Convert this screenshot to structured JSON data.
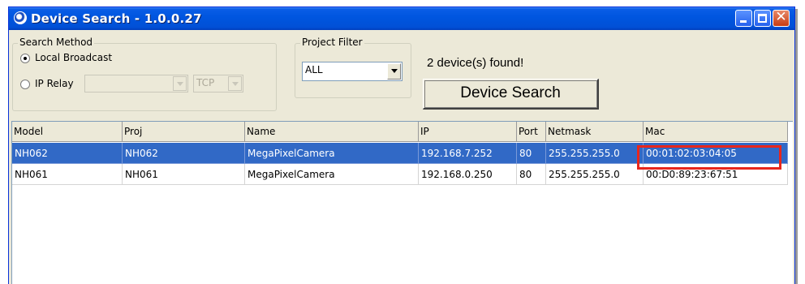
{
  "window": {
    "title": "Device Search - 1.0.0.27"
  },
  "search_method": {
    "legend": "Search Method",
    "local_broadcast_label": "Local Broadcast",
    "ip_relay_label": "IP Relay",
    "ip_relay_value": "",
    "protocol_value": "TCP",
    "selected": "Local Broadcast"
  },
  "project_filter": {
    "legend": "Project Filter",
    "value": "ALL"
  },
  "status_text": "2 device(s) found!",
  "search_button_label": "Device Search",
  "table": {
    "columns": [
      "Model",
      "Proj",
      "Name",
      "IP",
      "Port",
      "Netmask",
      "Mac"
    ],
    "rows": [
      [
        "NH062",
        "NH062",
        "MegaPixelCamera",
        "192.168.7.252",
        "80",
        "255.255.255.0",
        "00:01:02:03:04:05"
      ],
      [
        "NH061",
        "NH061",
        "MegaPixelCamera",
        "192.168.0.250",
        "80",
        "255.255.255.0",
        "00:D0:89:23:67:51"
      ]
    ],
    "selected_row": 0
  },
  "colors": {
    "title_bar": "#0054e3",
    "selection": "#3169c6",
    "highlight_box": "#e8261c",
    "window_face": "#ece9d8"
  },
  "icons": [
    "app-icon",
    "minimize-icon",
    "maximize-icon",
    "close-icon",
    "chevron-down-icon"
  ]
}
